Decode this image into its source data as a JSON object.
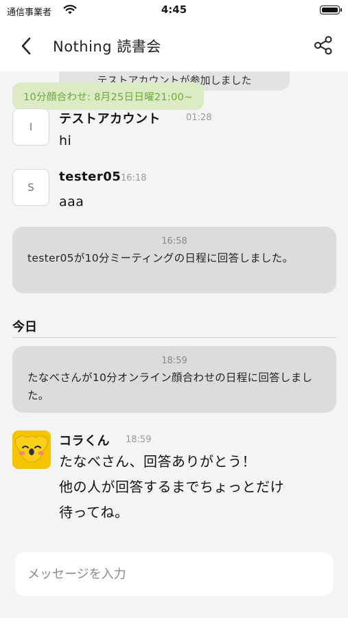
{
  "status_bar": {
    "carrier": "通信事業者",
    "time": "4:45"
  },
  "nav": {
    "title": "Nothing 読書会",
    "back_icon": "chevron-left-icon",
    "share_icon": "share-icon"
  },
  "chat": {
    "partial_system_text": "テストアカウントが参加しました",
    "pinned_event": "10分顔合わせ: 8月25日日曜21:00~",
    "messages": [
      {
        "avatar_letter": "I",
        "name": "テストアカウント",
        "time": "01:28",
        "text": "hi"
      },
      {
        "avatar_letter": "S",
        "name": "tester05",
        "time": "16:18",
        "text": "aaa"
      }
    ],
    "system_1": {
      "time": "16:58",
      "text": "tester05が10分ミーティングの日程に回答しました。"
    },
    "date_separator": "今日",
    "system_2": {
      "time": "18:59",
      "text": "たなべさんが10分オンライン顔合わせの日程に回答しました。"
    },
    "bot_message": {
      "name": "コラくん",
      "time": "18:59",
      "line1": "たなべさん、回答ありがとう！",
      "line2": "他の人が回答するまでちょっとだけ",
      "line3": "待ってね。"
    }
  },
  "composer": {
    "placeholder": "メッセージを入力",
    "value": ""
  },
  "colors": {
    "pinned_bg": "#dcebc4",
    "pinned_text": "#6aa83a",
    "bot_avatar": "#f5c400"
  }
}
